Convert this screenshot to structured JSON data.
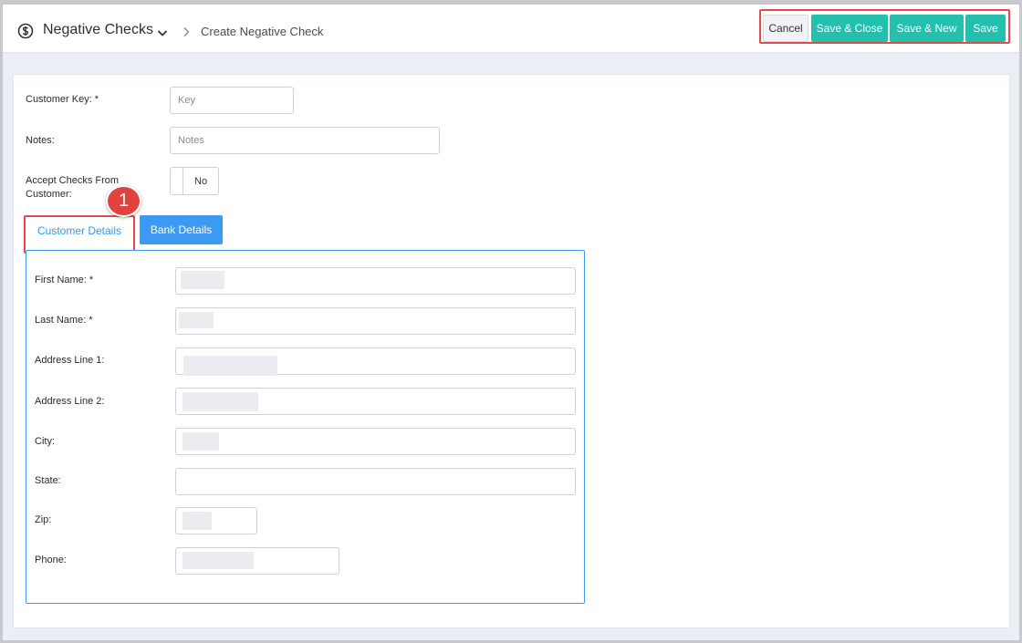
{
  "header": {
    "app_icon": "dollar-circle-icon",
    "app_title": "Negative Checks",
    "breadcrumb_current": "Create Negative Check"
  },
  "actions": {
    "cancel": "Cancel",
    "save_close": "Save & Close",
    "save_new": "Save & New",
    "save": "Save"
  },
  "form": {
    "customer_key": {
      "label": "Customer Key: *",
      "placeholder": "Key",
      "value": ""
    },
    "notes": {
      "label": "Notes:",
      "placeholder": "Notes",
      "value": ""
    },
    "accept_checks": {
      "label_line1": "Accept Checks From",
      "label_line2": "Customer:",
      "value": "No"
    }
  },
  "tabs": {
    "customer_details": "Customer Details",
    "bank_details": "Bank Details",
    "callout_number": "1"
  },
  "customer_details": {
    "first_name": {
      "label": "First Name: *",
      "value": ""
    },
    "last_name": {
      "label": "Last Name: *",
      "value": ""
    },
    "address1": {
      "label": "Address Line 1:",
      "value": ""
    },
    "address2": {
      "label": "Address Line 2:",
      "value": ""
    },
    "city": {
      "label": "City:",
      "value": ""
    },
    "state": {
      "label": "State:",
      "value": ""
    },
    "zip": {
      "label": "Zip:",
      "value": ""
    },
    "phone": {
      "label": "Phone:",
      "value": ""
    }
  },
  "colors": {
    "accent_teal": "#23c0ae",
    "accent_blue": "#3d9af2",
    "highlight_red": "#e14b4b"
  }
}
